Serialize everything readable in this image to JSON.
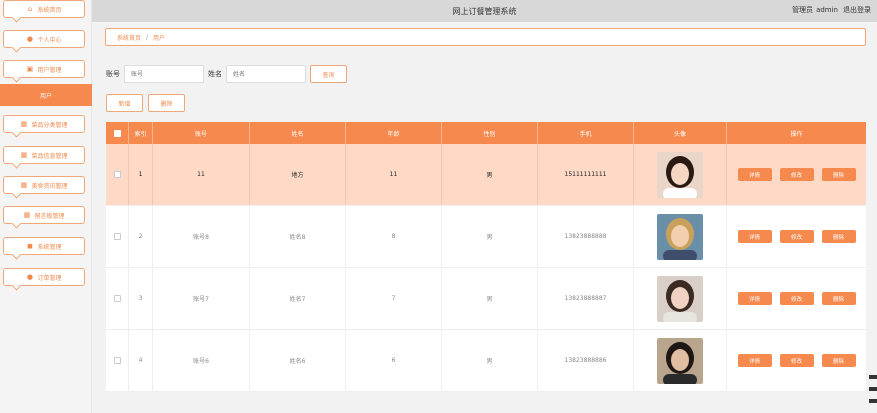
{
  "app": {
    "title": "网上订餐管理系统"
  },
  "header": {
    "role_label": "管理员",
    "username": "admin",
    "logout_label": "退出登录"
  },
  "sidebar": {
    "items": [
      {
        "label": "系统首页",
        "icon": "home-icon"
      },
      {
        "label": "个人中心",
        "icon": "person-icon"
      },
      {
        "label": "用户管理",
        "icon": "clipboard-icon"
      },
      {
        "label": "用户",
        "icon": ""
      },
      {
        "label": "菜品分类管理",
        "icon": "grid-icon"
      },
      {
        "label": "菜品信息管理",
        "icon": "grid-icon"
      },
      {
        "label": "美食资讯管理",
        "icon": "grid-icon"
      },
      {
        "label": "留言板管理",
        "icon": "grid-icon"
      },
      {
        "label": "系统管理",
        "icon": "bag-icon"
      },
      {
        "label": "订单管理",
        "icon": "person-icon"
      }
    ]
  },
  "breadcrumb": {
    "home": "系统首页",
    "sep": "/",
    "current": "用户"
  },
  "search": {
    "account_label": "账号",
    "account_placeholder": "账号",
    "name_label": "姓名",
    "name_placeholder": "姓名",
    "query_label": "查询"
  },
  "actions": {
    "add_label": "新增",
    "delete_label": "删除"
  },
  "table": {
    "headers": [
      "",
      "索引",
      "账号",
      "姓名",
      "年龄",
      "性别",
      "手机",
      "头像",
      "操作"
    ],
    "rows": [
      {
        "index": "1",
        "account": "11",
        "name": "地方",
        "age": "11",
        "gender": "男",
        "phone": "15111111111",
        "avatar": "avatar-1"
      },
      {
        "index": "2",
        "account": "账号8",
        "name": "姓名8",
        "age": "8",
        "gender": "男",
        "phone": "13823888888",
        "avatar": "avatar-2"
      },
      {
        "index": "3",
        "account": "账号7",
        "name": "姓名7",
        "age": "7",
        "gender": "男",
        "phone": "13823888887",
        "avatar": "avatar-3"
      },
      {
        "index": "4",
        "account": "账号6",
        "name": "姓名6",
        "age": "6",
        "gender": "男",
        "phone": "13823888886",
        "avatar": "avatar-4"
      }
    ],
    "op_labels": {
      "detail": "详情",
      "edit": "修改",
      "delete": "删除"
    }
  },
  "colors": {
    "accent": "#f6894d",
    "highlight_row": "#fdd9c6",
    "border": "#f0a878"
  }
}
